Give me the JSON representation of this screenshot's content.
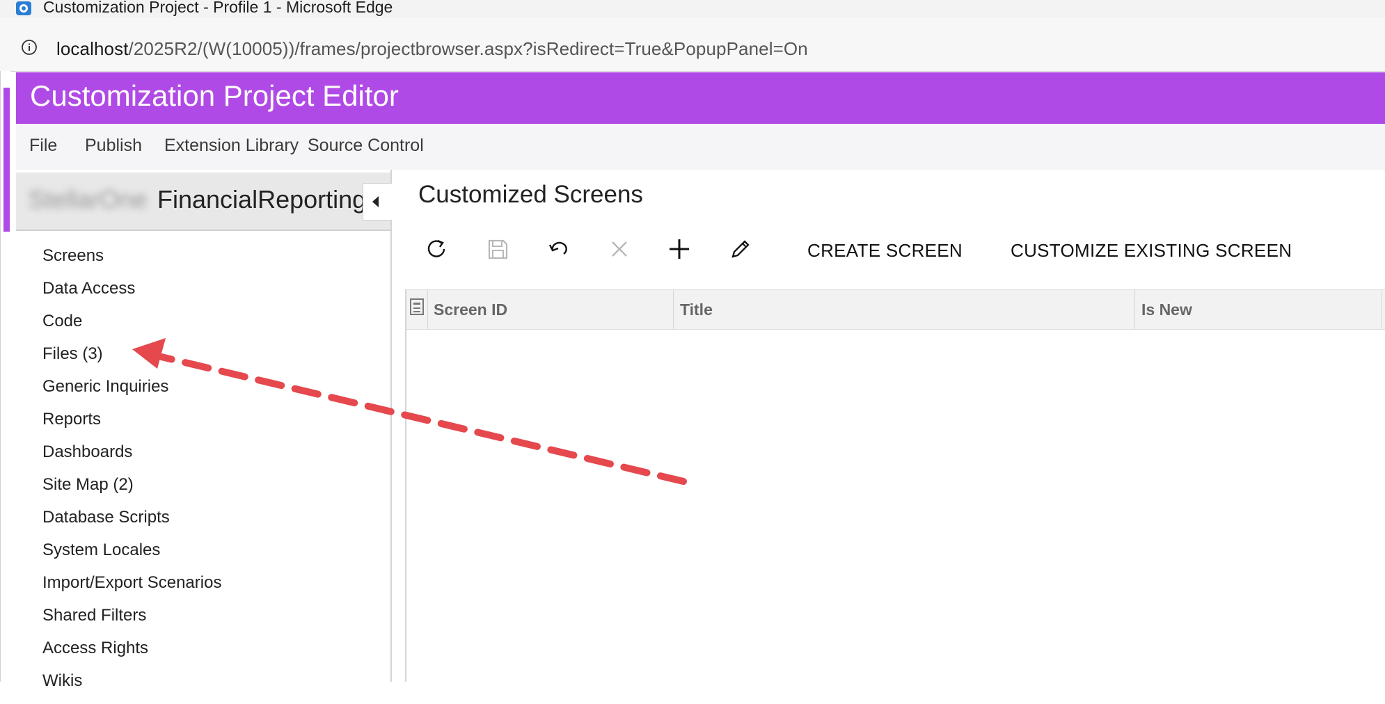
{
  "browser": {
    "window_title": "Customization Project - Profile 1 - Microsoft Edge",
    "url_host": "localhost",
    "url_path": "/2025R2/(W(10005))/frames/projectbrowser.aspx?isRedirect=True&PopupPanel=On"
  },
  "app": {
    "title": "Customization Project Editor",
    "accent_color": "#b04ae6"
  },
  "menu": [
    "File",
    "Publish",
    "Extension Library",
    "Source Control"
  ],
  "sidebar": {
    "project_prefix": "StellarOne",
    "project_name": "FinancialReporting",
    "items": [
      "Screens",
      "Data Access",
      "Code",
      "Files (3)",
      "Generic Inquiries",
      "Reports",
      "Dashboards",
      "Site Map (2)",
      "Database Scripts",
      "System Locales",
      "Import/Export Scenarios",
      "Shared Filters",
      "Access Rights",
      "Wikis"
    ]
  },
  "main": {
    "title": "Customized Screens",
    "toolbar": {
      "icons": [
        "refresh-icon",
        "save-icon",
        "undo-icon",
        "delete-icon",
        "add-icon",
        "edit-icon"
      ],
      "create_screen": "CREATE SCREEN",
      "customize_existing": "CUSTOMIZE EXISTING SCREEN"
    },
    "grid": {
      "columns": [
        "Screen ID",
        "Title",
        "Is New"
      ],
      "rows": []
    }
  },
  "annotation": {
    "arrow_color": "#e5484d",
    "target": "Files (3)"
  }
}
